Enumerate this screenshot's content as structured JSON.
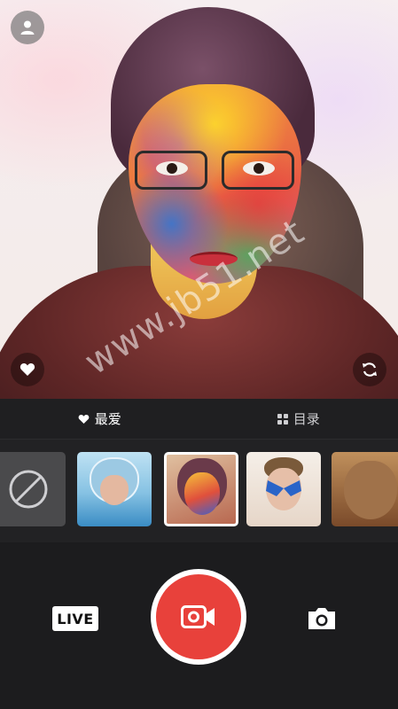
{
  "preview": {
    "watermark": "www.jb51.net"
  },
  "tabs": [
    {
      "label": "最爱",
      "icon": "heart-icon"
    },
    {
      "label": "目录",
      "icon": "grid-icon"
    }
  ],
  "filters": [
    {
      "name": "none",
      "icon": "no-filter-icon"
    },
    {
      "name": "shark"
    },
    {
      "name": "face-paint",
      "selected": true
    },
    {
      "name": "butterfly"
    },
    {
      "name": "ogre"
    }
  ],
  "controls": {
    "live_label": "LIVE"
  },
  "colors": {
    "record": "#e8413b",
    "background": "#1c1c1e"
  }
}
